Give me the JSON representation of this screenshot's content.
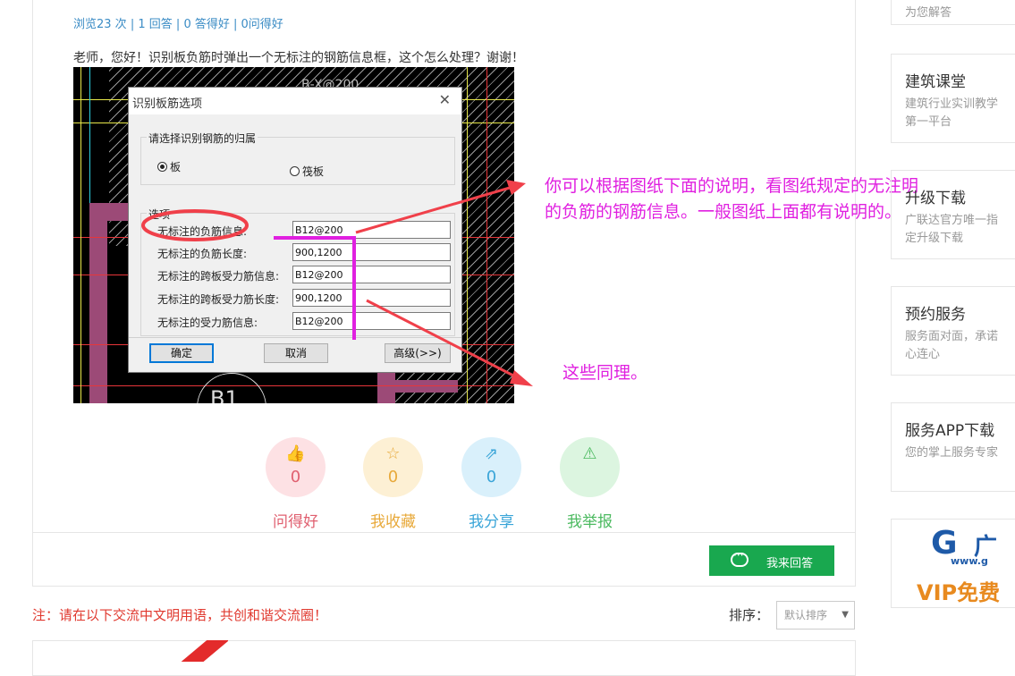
{
  "question": {
    "stats": {
      "views": "浏览23 次",
      "answers": "1 回答",
      "agree": "0 答得好",
      "asked_well": "0问得好",
      "sep": "|"
    },
    "text": "老师，您好！识别板负筋时弹出一个无标注的钢筋信息框，这个怎么处理？谢谢！"
  },
  "screenshot": {
    "cad_label": "B-X@200",
    "cad_circle_label": "B1",
    "dialog": {
      "title": "识别板筋选项",
      "close": "✕",
      "group1_label": "请选择识别钢筋的归属",
      "radio_board": "板",
      "radio_raft": "筏板",
      "group2_label": "选项",
      "rows": [
        {
          "label": "无标注的负筋信息:",
          "value": "B12@200"
        },
        {
          "label": "无标注的负筋长度:",
          "value": "900,1200"
        },
        {
          "label": "无标注的跨板受力筋信息:",
          "value": "B12@200"
        },
        {
          "label": "无标注的跨板受力筋长度:",
          "value": "900,1200"
        },
        {
          "label": "无标注的受力筋信息:",
          "value": "B12@200"
        }
      ],
      "btn_ok": "确定",
      "btn_cancel": "取消",
      "btn_advanced": "高级(>>)"
    },
    "annotation_color": "#e020e0",
    "arrow_color": "#f0404a"
  },
  "annotations": {
    "main": "你可以根据图纸下面的说明，看图纸规定的无注明的负筋的钢筋信息。一般图纸上面都有说明的。",
    "second": "这些同理。"
  },
  "actions": [
    {
      "icon": "👍",
      "count": "0",
      "label": "问得好"
    },
    {
      "icon": "☆",
      "count": "0",
      "label": "我收藏"
    },
    {
      "icon": "⇗",
      "count": "0",
      "label": "我分享"
    },
    {
      "icon": "⚠",
      "count": "0",
      "label": "我举报"
    }
  ],
  "answer_button": "我来回答",
  "notice": "注：请在以下交流中文明用语，共创和谐交流圈！",
  "sort": {
    "label": "排序：",
    "selected": "默认排序",
    "caret": "▼"
  },
  "sidebar": {
    "top_text": "为您解答",
    "cards": [
      {
        "title": "建筑课堂",
        "desc": "建筑行业实训教学第一平台"
      },
      {
        "title": "升级下载",
        "desc": "广联达官方唯一指定升级下载"
      },
      {
        "title": "预约服务",
        "desc": "服务面对面，承诺心连心"
      },
      {
        "title": "服务APP下载",
        "desc": "您的掌上服务专家"
      }
    ],
    "banner": {
      "logo_text": "广",
      "url_text": "www.g",
      "vip_text": "VIP免费"
    }
  },
  "colors": {
    "link_blue": "#3b8cc5",
    "green": "#19a84f",
    "notice_red": "#e0382e"
  }
}
